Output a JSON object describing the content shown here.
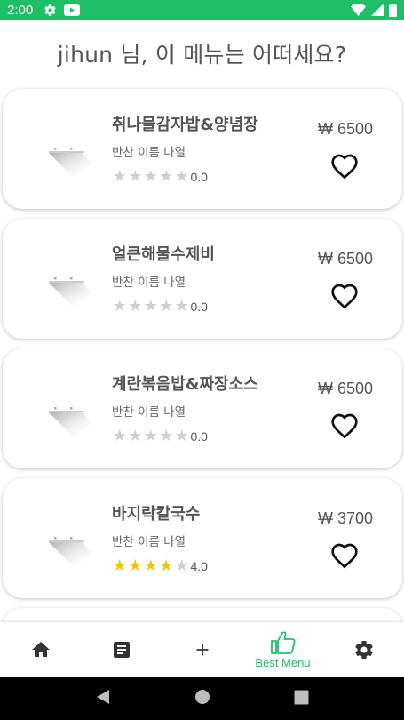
{
  "status_bar": {
    "time": "2:00"
  },
  "header": {
    "greeting": "jihun 님, 이 메뉴는 어떠세요?"
  },
  "menu_items": [
    {
      "name": "취나물감자밥&양념장",
      "description": "반찬 이름 나열",
      "rating": 0,
      "rating_label": "0.0",
      "price": "₩ 6500"
    },
    {
      "name": "얼큰해물수제비",
      "description": "반찬 이름 나열",
      "rating": 0,
      "rating_label": "0.0",
      "price": "₩ 6500"
    },
    {
      "name": "계란볶음밥&짜장소스",
      "description": "반찬 이름 나열",
      "rating": 0,
      "rating_label": "0.0",
      "price": "₩ 6500"
    },
    {
      "name": "바지락칼국수",
      "description": "반찬 이름 나열",
      "rating": 4,
      "rating_label": "4.0",
      "price": "₩ 3700"
    }
  ],
  "bottom_nav": {
    "items": [
      {
        "icon": "home-icon",
        "label": ""
      },
      {
        "icon": "note-icon",
        "label": ""
      },
      {
        "icon": "plus-icon",
        "label": ""
      },
      {
        "icon": "thumbs-up-icon",
        "label": "Best Menu",
        "active": true
      },
      {
        "icon": "gear-icon",
        "label": ""
      }
    ]
  },
  "colors": {
    "accent": "#1fbf6a",
    "star_on": "#f5c400",
    "star_off": "#cfcfcf"
  }
}
